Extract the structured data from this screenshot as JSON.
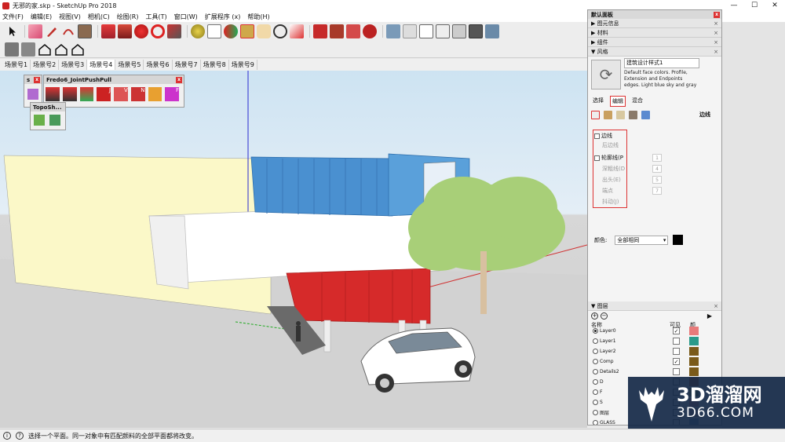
{
  "window": {
    "title": "无邪的家.skp - SketchUp Pro 2018",
    "min": "—",
    "max": "☐",
    "close": "✕"
  },
  "menu": [
    "文件(F)",
    "编辑(E)",
    "视图(V)",
    "相机(C)",
    "绘图(R)",
    "工具(T)",
    "窗口(W)",
    "扩展程序 (x)",
    "帮助(H)"
  ],
  "scenes": [
    "场景号1",
    "场景号2",
    "场景号3",
    "场景号4",
    "场景号5",
    "场景号6",
    "场景号7",
    "场景号8",
    "场景号9"
  ],
  "floatbars": {
    "small_title": "s",
    "fredo_title": "Fredo6_JointPushPull",
    "topo_title": "TopoSh...",
    "fredo_letters": [
      "J",
      "V",
      "N",
      "F"
    ]
  },
  "panel": {
    "title": "默认面板",
    "trays": [
      {
        "label": "图元信息",
        "state": "▶"
      },
      {
        "label": "材料",
        "state": "▶"
      },
      {
        "label": "组件",
        "state": "▶"
      },
      {
        "label": "风格",
        "state": "▼"
      }
    ],
    "style": {
      "name": "建筑设计样式1",
      "description": "Default face colors. Profile, Extension and Endpoints edges. Light blue sky and gray",
      "tabs": [
        "选择",
        "编辑",
        "混合"
      ],
      "selected_tab": "编辑",
      "section_label": "边线",
      "edges": {
        "edge": "边线",
        "back_edge": "后边线",
        "profile": "轮廓线(P",
        "depth_cue": "深粗线(D",
        "extension": "出头(E)",
        "endpoints": "端点",
        "jitter": "抖动(J)",
        "profile_val": "1",
        "depth_val": "4",
        "ext_val": "5",
        "end_val": "7"
      },
      "color_label": "颜色:",
      "color_value": "全部相同"
    },
    "layers": {
      "title": "图层",
      "header_name": "名称",
      "header_visible": "可见",
      "header_color": "颜",
      "items": [
        {
          "name": "Layer0",
          "active": true,
          "visible": true,
          "color": "#e87a7a"
        },
        {
          "name": "Layer1",
          "active": false,
          "visible": false,
          "color": "#2a9a8a"
        },
        {
          "name": "Layer2",
          "active": false,
          "visible": false,
          "color": "#7a5a1a"
        },
        {
          "name": "Comp",
          "active": false,
          "visible": true,
          "color": "#7a5a1a"
        },
        {
          "name": "Details2",
          "active": false,
          "visible": false,
          "color": "#7a5a1a"
        },
        {
          "name": "D",
          "active": false,
          "visible": false,
          "color": "#c86a3a"
        },
        {
          "name": "F",
          "active": false,
          "visible": false,
          "color": "#7a8a3a"
        },
        {
          "name": "S",
          "active": false,
          "visible": false,
          "color": "#e88a8a"
        },
        {
          "name": "图层",
          "active": false,
          "visible": false,
          "color": "#c8a8a8"
        },
        {
          "name": "GLASS",
          "active": false,
          "visible": false,
          "color": "#7aa8c8"
        }
      ]
    }
  },
  "status": {
    "text": "选择一个平面。同一对象中有匹配颜料的全部平面都将改变。",
    "icon1": "i",
    "icon2": "?"
  },
  "watermark": {
    "title": "3D溜溜网",
    "subtitle": "3D66.COM"
  },
  "colors": {
    "accent_red": "#d33333",
    "container_blue": "#4a90d0",
    "container_red": "#d62a2a",
    "tree_green": "#a8cf78"
  }
}
